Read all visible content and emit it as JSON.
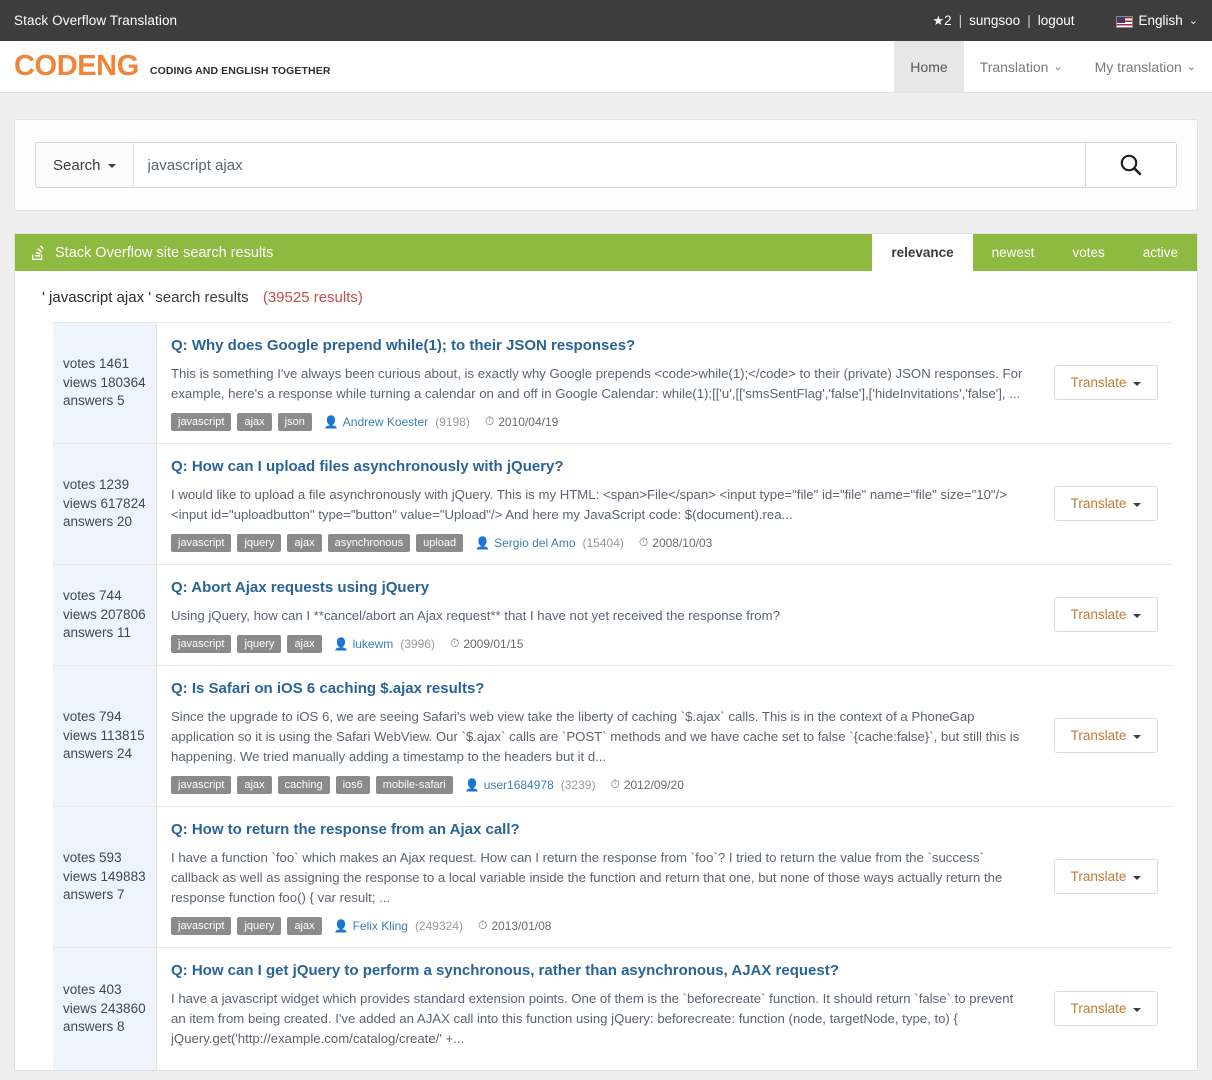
{
  "topbar": {
    "title": "Stack Overflow Translation",
    "star_icon": "star-icon",
    "star_count": "2",
    "sep1": "|",
    "username": "sungsoo",
    "sep2": "|",
    "logout_label": "logout",
    "flag_icon": "us-flag-icon",
    "language": "English",
    "language_chevron": "chevron-down-icon"
  },
  "brand": {
    "logo": "CODENG",
    "tagline": "CODING AND ENGLISH TOGETHER"
  },
  "nav": {
    "items": [
      {
        "label": "Home",
        "active": true,
        "caret": false
      },
      {
        "label": "Translation",
        "active": false,
        "caret": true
      },
      {
        "label": "My translation",
        "active": false,
        "caret": true
      }
    ]
  },
  "search": {
    "scope_label": "Search",
    "scope_caret": "caret-down-icon",
    "value": "javascript ajax",
    "placeholder": "",
    "submit_icon": "search-icon"
  },
  "results_header": {
    "icon": "stack-overflow-icon",
    "title": "Stack Overflow site search results",
    "sort_tabs": [
      {
        "label": "relevance",
        "active": true
      },
      {
        "label": "newest",
        "active": false
      },
      {
        "label": "votes",
        "active": false
      },
      {
        "label": "active",
        "active": false
      }
    ]
  },
  "results_summary": {
    "query": "' javascript ajax '",
    "label": "search results",
    "count": "(39525 results)"
  },
  "labels": {
    "votes": "votes",
    "views": "views",
    "answers": "answers",
    "translate": "Translate",
    "translate_caret": "caret-down-icon",
    "user_icon": "person-icon",
    "date_icon": "clock-icon"
  },
  "results": [
    {
      "votes": "1461",
      "views": "180364",
      "answers": "5",
      "title": "Q: Why does Google prepend while(1); to their JSON responses?",
      "excerpt": "This is something I've always been curious about, is exactly why Google prepends <code>while(1);</code> to their (private) JSON responses. For example, here's a response while turning a calendar on and off in Google Calendar: while(1);[['u',[['smsSentFlag','false'],['hideInvitations','false'], ...",
      "tags": [
        "javascript",
        "ajax",
        "json"
      ],
      "user": "Andrew Koester",
      "reputation": "(9198)",
      "date": "2010/04/19"
    },
    {
      "votes": "1239",
      "views": "617824",
      "answers": "20",
      "title": "Q: How can I upload files asynchronously with jQuery?",
      "excerpt": "I would like to upload a file asynchronously with jQuery. This is my HTML: <span>File</span> <input type=\"file\" id=\"file\" name=\"file\" size=\"10\"/> <input id=\"uploadbutton\" type=\"button\" value=\"Upload\"/> And here my JavaScript code: $(document).rea...",
      "tags": [
        "javascript",
        "jquery",
        "ajax",
        "asynchronous",
        "upload"
      ],
      "user": "Sergio del Amo",
      "reputation": "(15404)",
      "date": "2008/10/03"
    },
    {
      "votes": "744",
      "views": "207806",
      "answers": "11",
      "title": "Q: Abort Ajax requests using jQuery",
      "excerpt": "Using jQuery, how can I **cancel/abort an Ajax request** that I have not yet received the response from?",
      "tags": [
        "javascript",
        "jquery",
        "ajax"
      ],
      "user": "lukewm",
      "reputation": "(3996)",
      "date": "2009/01/15"
    },
    {
      "votes": "794",
      "views": "113815",
      "answers": "24",
      "title": "Q: Is Safari on iOS 6 caching $.ajax results?",
      "excerpt": "Since the upgrade to iOS 6, we are seeing Safari's web view take the liberty of caching `$.ajax` calls. This is in the context of a PhoneGap application so it is using the Safari WebView. Our `$.ajax` calls are `POST` methods and we have cache set to false `{cache:false}`, but still this is happening. We tried manually adding a timestamp to the headers but it d...",
      "tags": [
        "javascript",
        "ajax",
        "caching",
        "ios6",
        "mobile-safari"
      ],
      "user": "user1684978",
      "reputation": "(3239)",
      "date": "2012/09/20"
    },
    {
      "votes": "593",
      "views": "149883",
      "answers": "7",
      "title": "Q: How to return the response from an Ajax call?",
      "excerpt": "I have a function `foo` which makes an Ajax request. How can I return the response from `foo`? I tried to return the value from the `success` callback as well as assigning the response to a local variable inside the function and return that one, but none of those ways actually return the response function foo() { var result; ...",
      "tags": [
        "javascript",
        "jquery",
        "ajax"
      ],
      "user": "Felix Kling",
      "reputation": "(249324)",
      "date": "2013/01/08"
    },
    {
      "votes": "403",
      "views": "243860",
      "answers": "8",
      "title": "Q: How can I get jQuery to perform a synchronous, rather than asynchronous, AJAX request?",
      "excerpt": "I have a javascript widget which provides standard extension points. One of them is the `beforecreate` function. It should return `false` to prevent an item from being created. I've added an AJAX call into this function using jQuery: beforecreate: function (node, targetNode, type, to) { jQuery.get('http://example.com/catalog/create/' +...",
      "tags": [],
      "user": "",
      "reputation": "",
      "date": ""
    }
  ],
  "colors": {
    "topbar_bg": "#3d3d3d",
    "brand_orange": "#f08437",
    "results_green": "#8fba41",
    "title_blue": "#2a6496",
    "count_red": "#c0504d",
    "stats_bg": "#eef4fb",
    "tag_gray": "#8b8b8b",
    "translate_text": "#c07a33"
  }
}
